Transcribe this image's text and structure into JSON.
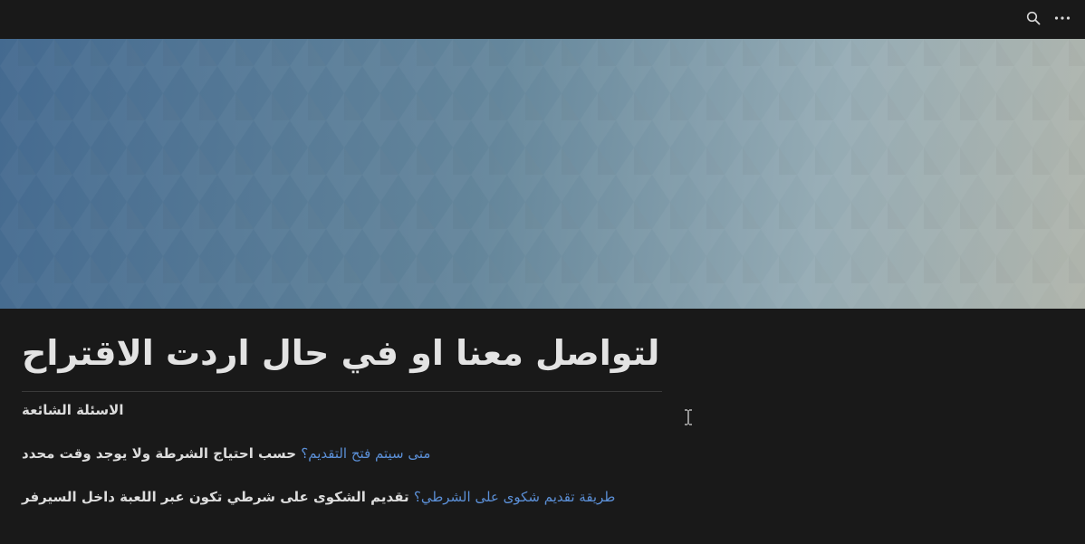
{
  "topbar": {
    "icons": [
      "search-icon",
      "more-options-icon"
    ]
  },
  "cover": {
    "colors": [
      "#4a7199",
      "#7aa4b8",
      "#aebfbf"
    ]
  },
  "page": {
    "title": "لتواصل معنا او في حال اردت الاقتراح",
    "faq_heading": "الاسئلة الشائعة",
    "faq": [
      {
        "question": "متى سيتم فتح التقديم؟",
        "answer": "حسب احتياج الشرطة ولا يوجد وقت محدد"
      },
      {
        "question": "طريقة تقديم شكوى على الشرطي؟",
        "answer": "تقديم الشكوى على شرطي تكون عبر اللعبة داخل السيرفر"
      }
    ]
  },
  "colors": {
    "background": "#191919",
    "text": "#dcdcdc",
    "link": "#5b8fd6",
    "divider": "#3a3a3a"
  }
}
